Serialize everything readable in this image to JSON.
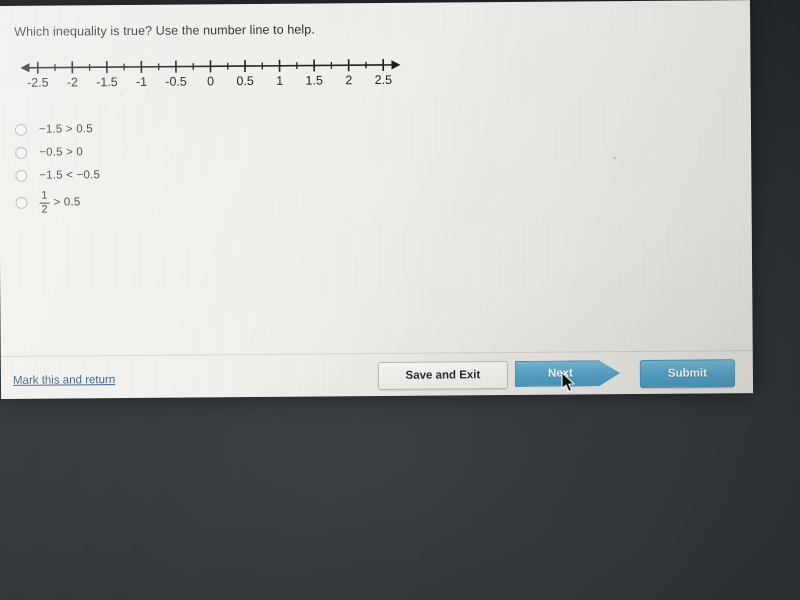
{
  "question": {
    "text": "Which inequality is true? Use the number line to help."
  },
  "number_line": {
    "min": -2.75,
    "max": 2.75,
    "major_step": 0.5,
    "minor_step": 0.25,
    "labels": [
      {
        "value": -2.5,
        "text": "-2.5"
      },
      {
        "value": -2,
        "text": "-2"
      },
      {
        "value": -1.5,
        "text": "-1.5"
      },
      {
        "value": -1,
        "text": "-1"
      },
      {
        "value": -0.5,
        "text": "-0.5"
      },
      {
        "value": 0,
        "text": "0"
      },
      {
        "value": 0.5,
        "text": "0.5"
      },
      {
        "value": 1,
        "text": "1"
      },
      {
        "value": 1.5,
        "text": "1.5"
      },
      {
        "value": 2,
        "text": "2"
      },
      {
        "value": 2.5,
        "text": "2.5"
      }
    ],
    "left_arrow": true,
    "right_arrow": true
  },
  "options": [
    {
      "id": "option-a",
      "text": "−1.5 > 0.5",
      "selected": false,
      "type": "plain"
    },
    {
      "id": "option-b",
      "text": "−0.5 > 0",
      "selected": false,
      "type": "plain"
    },
    {
      "id": "option-c",
      "text": "−1.5 < −0.5",
      "selected": false,
      "type": "plain"
    },
    {
      "id": "option-d",
      "text": "> 0.5",
      "selected": false,
      "type": "fraction",
      "numerator": "1",
      "denominator": "2"
    }
  ],
  "footer": {
    "mark_link": "Mark this and return",
    "save_label": "Save and Exit",
    "next_label": "Next",
    "submit_label": "Submit"
  },
  "colors": {
    "page_background": "#f2f0ec",
    "screen_surround": "#33373a",
    "button_blue": "#5aa8cd",
    "link_blue": "#3b5f86",
    "text": "#2c2c2c"
  }
}
